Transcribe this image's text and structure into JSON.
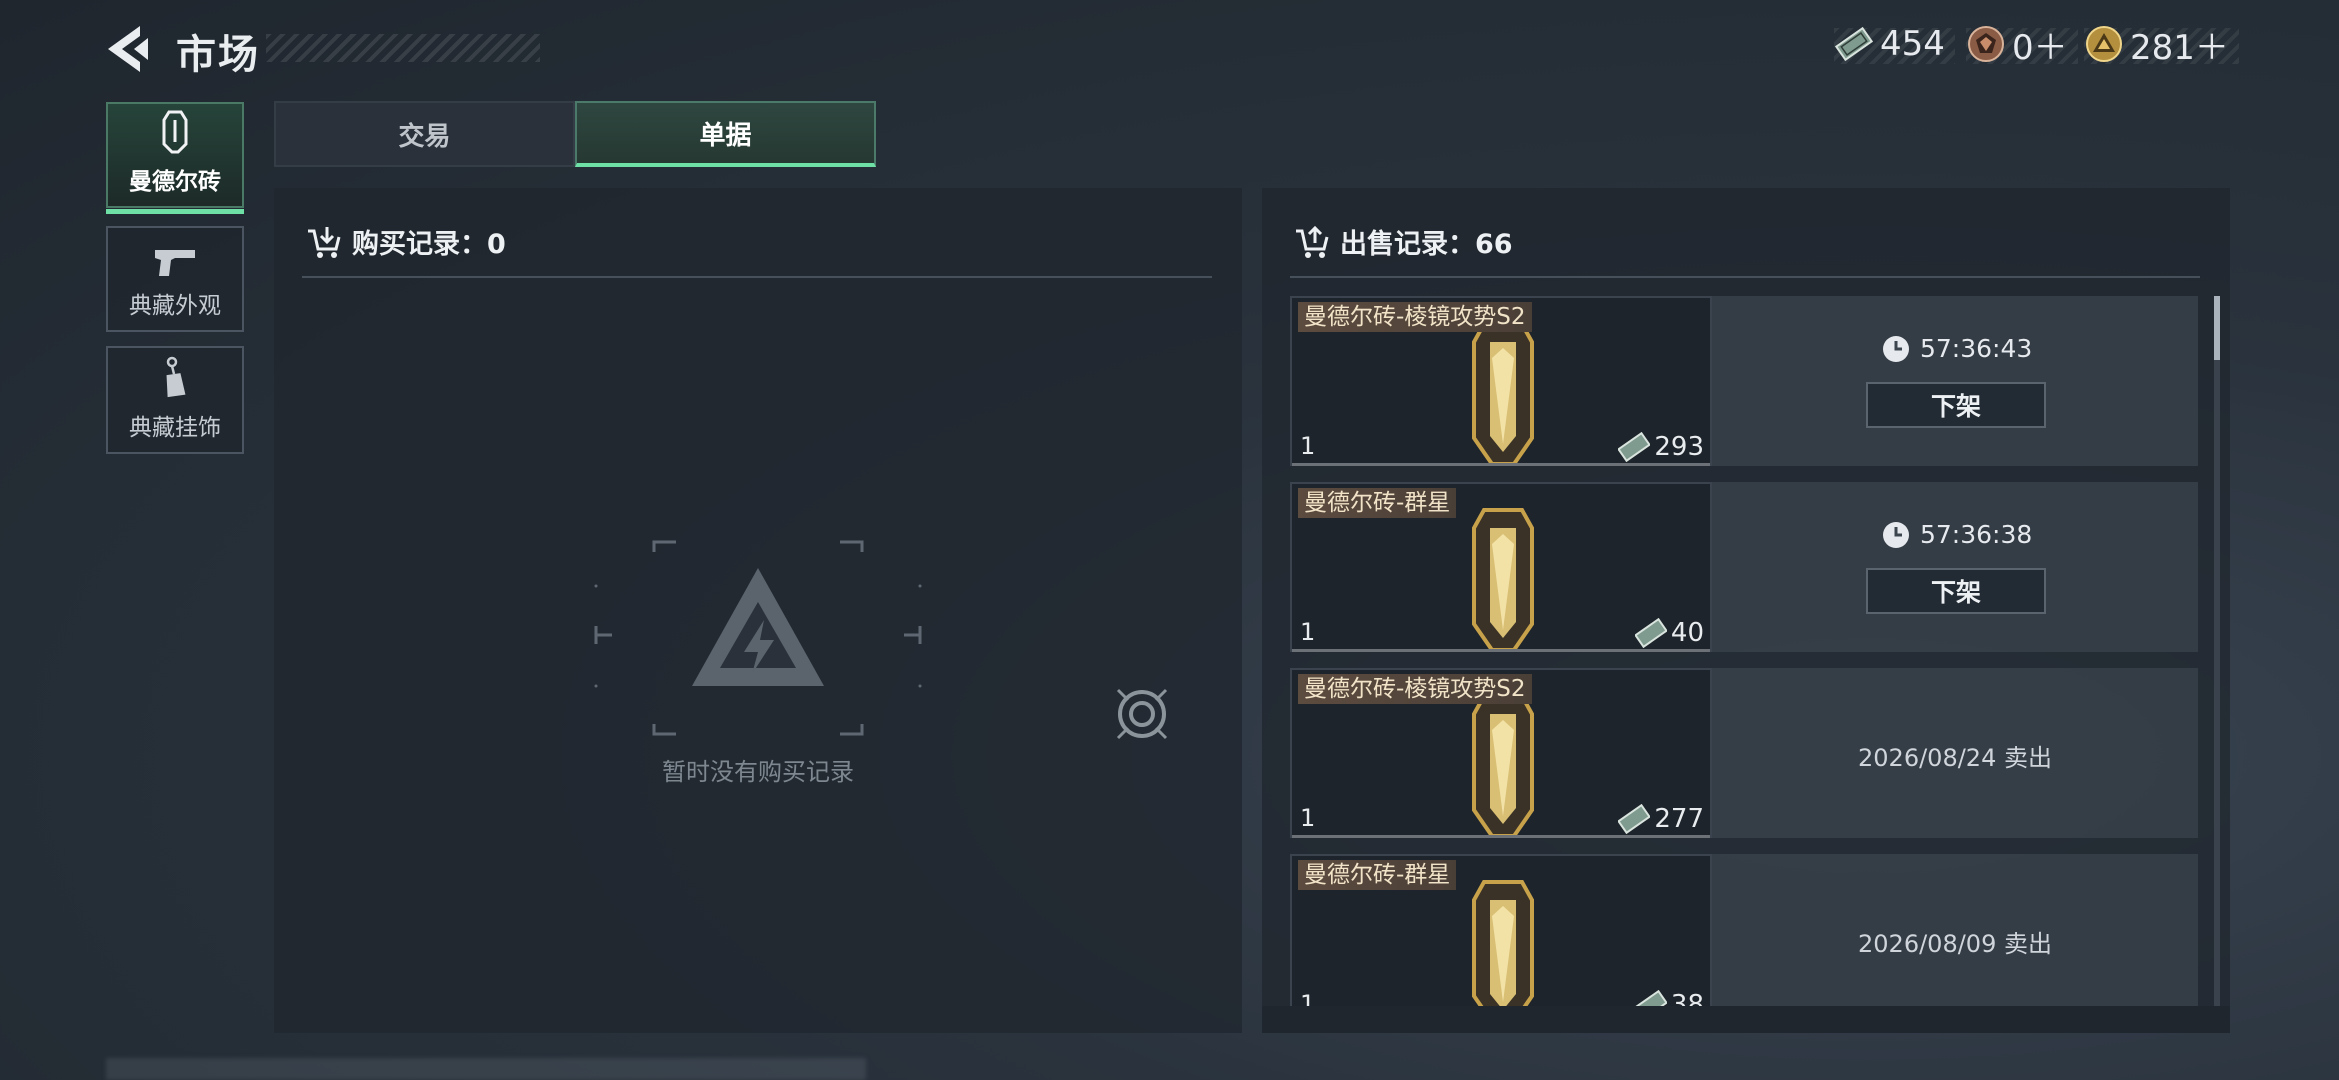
{
  "header": {
    "title": "市场",
    "currencies": [
      {
        "icon": "cash-icon",
        "value": "454"
      },
      {
        "icon": "bronze-coin-icon",
        "value": "0＋"
      },
      {
        "icon": "gold-coin-icon",
        "value": "281＋"
      }
    ]
  },
  "sidebar": {
    "items": [
      {
        "label": "曼德尔砖",
        "icon": "mandel-brick-icon",
        "active": true
      },
      {
        "label": "典藏外观",
        "icon": "pistol-icon",
        "active": false
      },
      {
        "label": "典藏挂饰",
        "icon": "charm-icon",
        "active": false
      }
    ]
  },
  "tabs": [
    {
      "label": "交易",
      "active": false
    },
    {
      "label": "单据",
      "active": true
    }
  ],
  "purchase": {
    "title": "购买记录：0",
    "empty_text": "暂时没有购买记录"
  },
  "sales": {
    "title": "出售记录：66",
    "records": [
      {
        "name": "曼德尔砖-棱镜攻势S2",
        "qty": "1",
        "price": "293",
        "timer": "57:36:43",
        "action": "下架",
        "status": ""
      },
      {
        "name": "曼德尔砖-群星",
        "qty": "1",
        "price": "40",
        "timer": "57:36:38",
        "action": "下架",
        "status": ""
      },
      {
        "name": "曼德尔砖-棱镜攻势S2",
        "qty": "1",
        "price": "277",
        "timer": "",
        "action": "",
        "status": "2026/08/24 卖出"
      },
      {
        "name": "曼德尔砖-群星",
        "qty": "1",
        "price": "38",
        "timer": "",
        "action": "",
        "status": "2026/08/09 卖出"
      }
    ]
  },
  "colors": {
    "accent": "#6ee0a6",
    "name_tag": "#5c4b3f",
    "gold": "#c8a24a"
  }
}
